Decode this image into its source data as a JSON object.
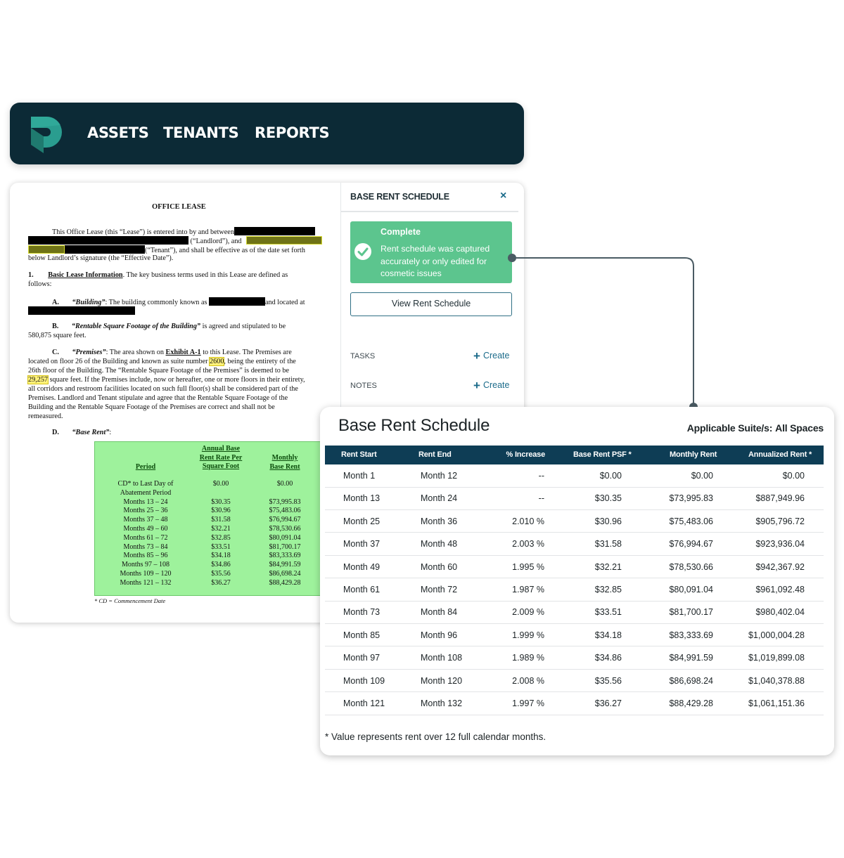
{
  "nav": {
    "items": [
      "ASSETS",
      "TENANTS",
      "REPORTS"
    ],
    "brand_color": "#0c2a36",
    "logo_color": "#2a9d8f"
  },
  "lease": {
    "title": "OFFICE LEASE",
    "intro": {
      "line1": "This Office Lease (this “Lease”) is entered into by and between",
      "landlord": "(“Landlord”),  and",
      "tenant": "(“Tenant”), and shall be effective as of the date set forth",
      "effective": "below Landlord’s signature (the “Effective Date”)."
    },
    "section1": {
      "num": "1.",
      "heading": "Basic Lease Information",
      "text": ". The key business terms used in this Lease are defined as",
      "cont": "follows:"
    },
    "a": {
      "label": "A.",
      "term": "“Building”",
      "text": ": The building commonly known as",
      "tail": "and located at"
    },
    "b": {
      "label": "B.",
      "term": "“Rentable Square Footage of the Building”",
      "text": " is agreed and stipulated to be",
      "cont": "580,875 square feet."
    },
    "c": {
      "label": "C.",
      "term": "“Premises”",
      "text1": ": The area shown on ",
      "exhibit": "Exhibit A-1",
      "text1b": " to this Lease. The Premises are",
      "line2a": "located on floor 26 of the Building and known as suite number ",
      "suite_number": "2600",
      "line2b": ", being the entirety of the",
      "line3": "26th floor of the Building. The “Rentable Square Footage of the Premises” is deemed to be",
      "sqft": "29,257",
      "line4": " square feet. If the Premises include, now or hereafter, one or more floors in their entirety,",
      "line5": "all corridors and restroom facilities located on such full floor(s) shall be considered part of the",
      "line6": "Premises. Landlord and Tenant stipulate and agree that the Rentable Square Footage of the",
      "line7": "Building and the Rentable Square Footage of the Premises are correct and shall not be",
      "line8": "remeasured."
    },
    "d": {
      "label": "D.",
      "term": "“Base Rent”",
      "colon": ":"
    },
    "rent_table": {
      "h_period": "Period",
      "h_rate": "Annual Base Rent Rate Per Square Foot",
      "h_rate_l1": "Annual Base",
      "h_rate_l2": "Rent Rate Per",
      "h_rate_l3": "Square Foot",
      "h_monthly_l1": "Monthly",
      "h_monthly_l2": "Base Rent",
      "periods": [
        "CD* to Last Day of",
        "Abatement Period",
        "Months 13 – 24",
        "Months 25 – 36",
        "Months 37 – 48",
        "Months 49 – 60",
        "Months 61 – 72",
        "Months 73 – 84",
        "Months 85 – 96",
        "Months 97 – 108",
        "Months 109 – 120",
        "Months 121 – 132"
      ],
      "rates": [
        "$0.00",
        "",
        "$30.35",
        "$30.96",
        "$31.58",
        "$32.21",
        "$32.85",
        "$33.51",
        "$34.18",
        "$34.86",
        "$35.56",
        "$36.27"
      ],
      "monthly": [
        "$0.00",
        "",
        "$73,995.83",
        "$75,483.06",
        "$76,994.67",
        "$78,530.66",
        "$80,091.04",
        "$81,700.17",
        "$83,333.69",
        "$84,991.59",
        "$86,698.24",
        "$88,429.28"
      ],
      "footnote": "*   CD = Commencement Date",
      "highlight_color": "#9ef29c"
    }
  },
  "panel": {
    "title": "BASE RENT SCHEDULE",
    "close_label": "×",
    "status": {
      "heading": "Complete",
      "message": "Rent schedule was captured accurately or only edited for cosmetic issues",
      "color": "#5cc58e"
    },
    "view_button": "View Rent Schedule",
    "tasks_label": "TASKS",
    "notes_label": "NOTES",
    "create_label": "Create",
    "accent": "#1b6b8a"
  },
  "schedule": {
    "title": "Base Rent Schedule",
    "suite_label": "Applicable Suite/s:",
    "suite_value": "All Spaces",
    "header_color": "#0e3d55",
    "columns": [
      "Rent Start",
      "Rent End",
      "% Increase",
      "Base Rent PSF *",
      "Monthly Rent",
      "Annualized Rent *"
    ],
    "rows": [
      [
        "Month 1",
        "Month 12",
        "--",
        "$0.00",
        "$0.00",
        "$0.00"
      ],
      [
        "Month 13",
        "Month 24",
        "--",
        "$30.35",
        "$73,995.83",
        "$887,949.96"
      ],
      [
        "Month 25",
        "Month 36",
        "2.010 %",
        "$30.96",
        "$75,483.06",
        "$905,796.72"
      ],
      [
        "Month 37",
        "Month 48",
        "2.003 %",
        "$31.58",
        "$76,994.67",
        "$923,936.04"
      ],
      [
        "Month 49",
        "Month 60",
        "1.995 %",
        "$32.21",
        "$78,530.66",
        "$942,367.92"
      ],
      [
        "Month 61",
        "Month 72",
        "1.987 %",
        "$32.85",
        "$80,091.04",
        "$961,092.48"
      ],
      [
        "Month 73",
        "Month 84",
        "2.009 %",
        "$33.51",
        "$81,700.17",
        "$980,402.04"
      ],
      [
        "Month 85",
        "Month 96",
        "1.999 %",
        "$34.18",
        "$83,333.69",
        "$1,000,004.28"
      ],
      [
        "Month 97",
        "Month 108",
        "1.989 %",
        "$34.86",
        "$84,991.59",
        "$1,019,899.08"
      ],
      [
        "Month 109",
        "Month 120",
        "2.008 %",
        "$35.56",
        "$86,698.24",
        "$1,040,378.88"
      ],
      [
        "Month 121",
        "Month 132",
        "1.997 %",
        "$36.27",
        "$88,429.28",
        "$1,061,151.36"
      ]
    ],
    "footnote": "* Value represents rent over 12 full calendar months."
  }
}
